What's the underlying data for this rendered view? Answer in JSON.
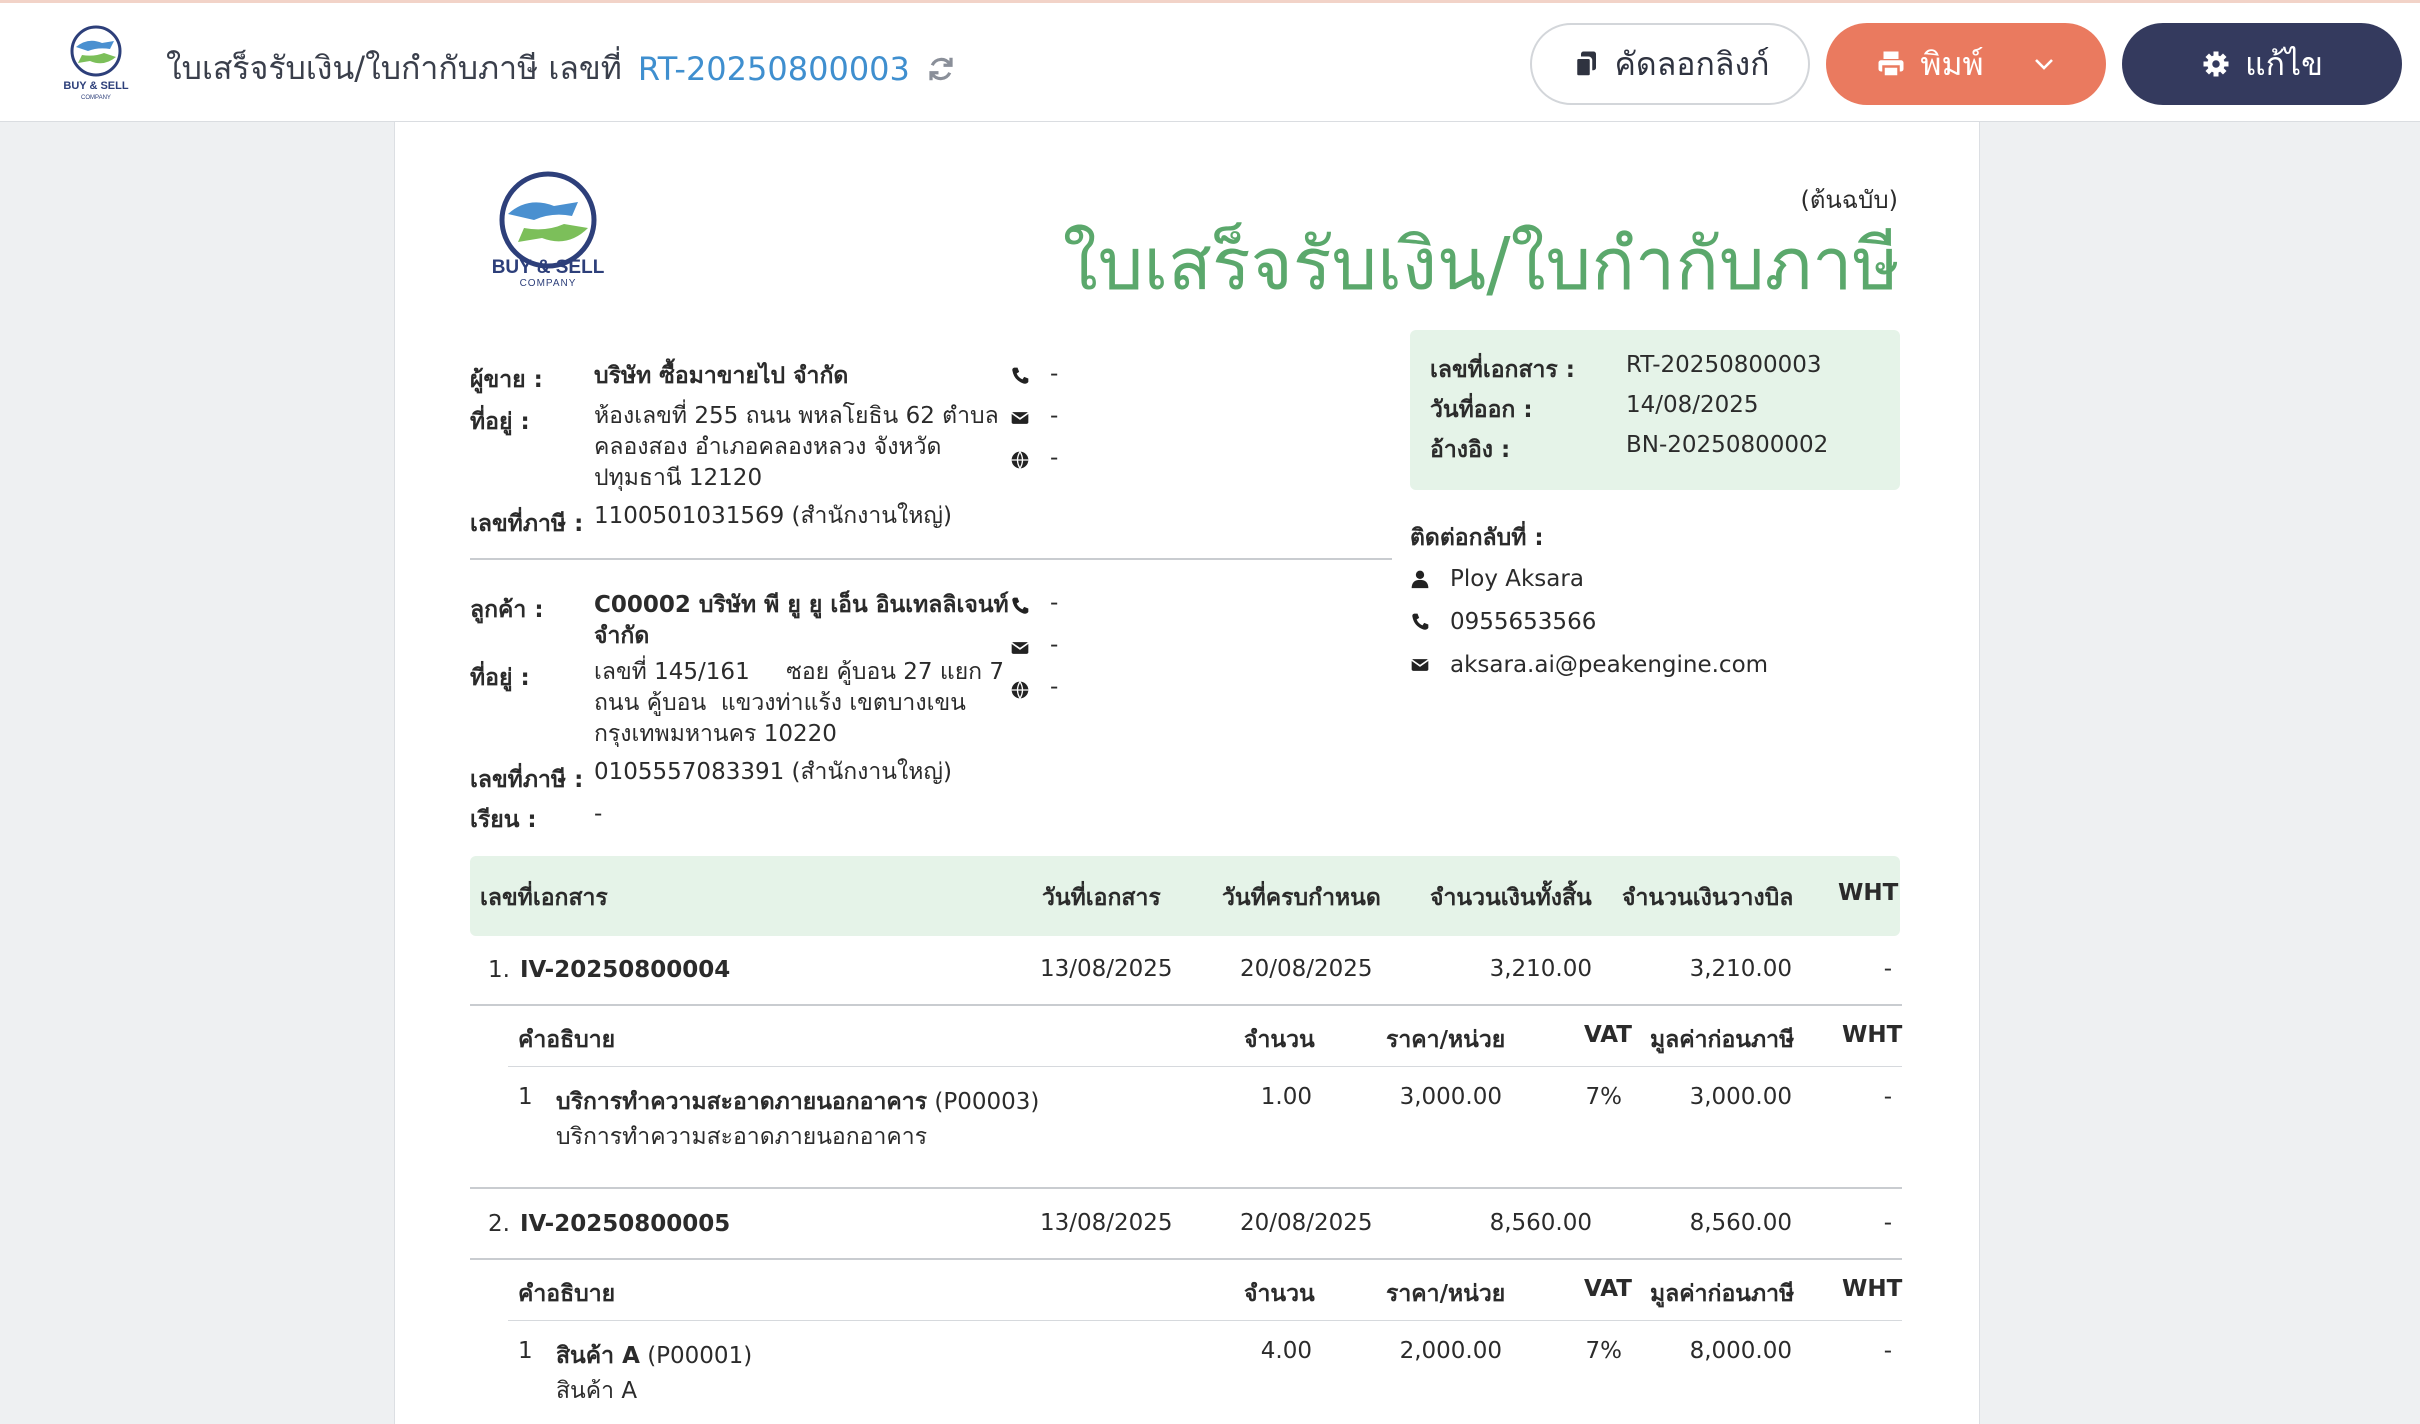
{
  "topbar": {
    "title": "ใบเสร็จรับเงิน/ใบกำกับภาษี เลขที่",
    "doc_number": "RT-20250800003",
    "copy_link_label": "คัดลอกลิงก์",
    "print_label": "พิมพ์",
    "edit_label": "แก้ไข",
    "logo_text": "BUY & SELL",
    "logo_sub": "COMPANY"
  },
  "document": {
    "logo_text": "BUY & SELL",
    "logo_sub": "COMPANY",
    "copy_type": "(ต้นฉบับ)",
    "title": "ใบเสร็จรับเงิน/ใบกำกับภาษี",
    "seller": {
      "label": "ผู้ขาย :",
      "name": "บริษัท ซื้อมาขายไป จำกัด",
      "address_label": "ที่อยู่ :",
      "address_line1": "ห้องเลขที่ 255 ถนน พหลโยธิน 62 ตำบล",
      "address_line2": "คลองสอง อำเภอคลองหลวง จังหวัด",
      "address_line3": "ปทุมธานี 12120",
      "tax_label": "เลขที่ภาษี :",
      "tax_id": "1100501031569 (สำนักงานใหญ่)",
      "phone": "-",
      "email": "-",
      "web": "-"
    },
    "customer": {
      "label": "ลูกค้า :",
      "name_line1": "C00002 บริษัท พี ยู ยู เอ็น อินเทลลิเจนท์",
      "name_line2": "จำกัด",
      "address_label": "ที่อยู่ :",
      "address_line1": "เลขที่ 145/161     ซอย คู้บอน 27 แยก 7",
      "address_line2": "ถนน คู้บอน  แขวงท่าแร้ง เขตบางเขน",
      "address_line3": "กรุงเทพมหานคร 10220",
      "tax_label": "เลขที่ภาษี :",
      "tax_id": "0105557083391 (สำนักงานใหญ่)",
      "attn_label": "เรียน :",
      "attn": "-",
      "phone": "-",
      "email": "-",
      "web": "-"
    },
    "info": {
      "docno_label": "เลขที่เอกสาร :",
      "docno": "RT-20250800003",
      "date_label": "วันที่ออก :",
      "date": "14/08/2025",
      "ref_label": "อ้างอิง :",
      "ref": "BN-20250800002"
    },
    "contact": {
      "title": "ติดต่อกลับที่ :",
      "name": "Ploy Aksara",
      "phone": "0955653566",
      "email": "aksara.ai@peakengine.com"
    },
    "table": {
      "headers": {
        "docno": "เลขที่เอกสาร",
        "doc_date": "วันที่เอกสาร",
        "due_date": "วันที่ครบกำหนด",
        "total": "จำนวนเงินทั้งสิ้น",
        "billed": "จำนวนเงินวางบิล",
        "wht": "WHT"
      },
      "sub_headers": {
        "desc": "คำอธิบาย",
        "qty": "จำนวน",
        "price": "ราคา/หน่วย",
        "vat": "VAT",
        "pretax": "มูลค่าก่อนภาษี",
        "wht": "WHT"
      },
      "rows": [
        {
          "index": "1.",
          "docno": "IV-20250800004",
          "doc_date": "13/08/2025",
          "due_date": "20/08/2025",
          "total": "3,210.00",
          "billed": "3,210.00",
          "wht": "-",
          "items": [
            {
              "no": "1",
              "name": "บริการทำความสะอาดภายนอกอาคาร",
              "code": "(P00003)",
              "desc": "บริการทำความสะอาดภายนอกอาคาร",
              "qty": "1.00",
              "price": "3,000.00",
              "vat": "7%",
              "pretax": "3,000.00",
              "wht": "-"
            }
          ]
        },
        {
          "index": "2.",
          "docno": "IV-20250800005",
          "doc_date": "13/08/2025",
          "due_date": "20/08/2025",
          "total": "8,560.00",
          "billed": "8,560.00",
          "wht": "-",
          "items": [
            {
              "no": "1",
              "name": "สินค้า A",
              "code": "(P00001)",
              "desc": "สินค้า A",
              "qty": "4.00",
              "price": "2,000.00",
              "vat": "7%",
              "pretax": "8,000.00",
              "wht": "-"
            }
          ]
        }
      ]
    }
  },
  "colors": {
    "title_green": "#5ba86c",
    "doc_link_blue": "#3f8fcf",
    "print_orange": "#ea7a5f",
    "edit_navy": "#343a5e",
    "box_green": "#e5f3e8"
  },
  "icons": [
    "refresh-icon",
    "copy-icon",
    "printer-icon",
    "chevron-down-icon",
    "gear-icon",
    "phone-icon",
    "envelope-icon",
    "globe-icon",
    "user-icon"
  ]
}
